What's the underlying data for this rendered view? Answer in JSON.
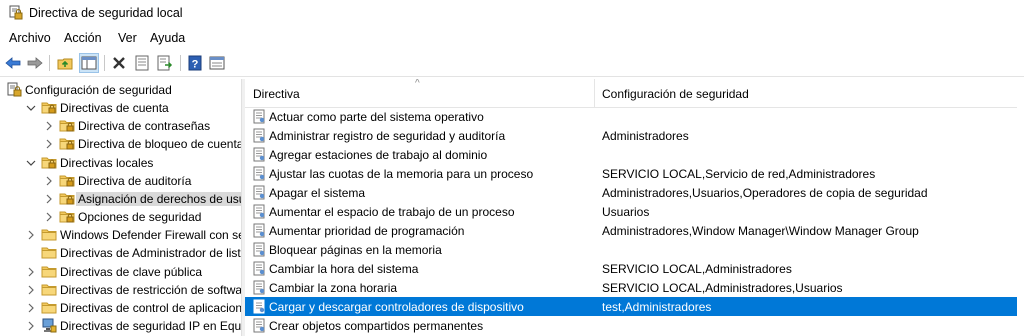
{
  "window": {
    "title": "Directiva de seguridad local"
  },
  "menu": [
    "Archivo",
    "Acción",
    "Ver",
    "Ayuda"
  ],
  "toolbar": {
    "icons": [
      "back-arrow-icon",
      "forward-arrow-icon",
      "up-folder-icon",
      "show-hide-tree-icon",
      "delete-icon",
      "properties-icon",
      "export-list-icon",
      "help-icon",
      "console-tree-icon"
    ]
  },
  "tree": {
    "items": [
      {
        "label": "Configuración de seguridad",
        "level": 0,
        "expander": "none",
        "icon": "security-config"
      },
      {
        "label": "Directivas de cuenta",
        "level": 1,
        "expander": "expanded",
        "icon": "folder-lock"
      },
      {
        "label": "Directiva de contraseñas",
        "level": 2,
        "expander": "collapsed",
        "icon": "folder-lock"
      },
      {
        "label": "Directiva de bloqueo de cuenta",
        "level": 2,
        "expander": "collapsed",
        "icon": "folder-lock"
      },
      {
        "label": "Directivas locales",
        "level": 1,
        "expander": "expanded",
        "icon": "folder-lock"
      },
      {
        "label": "Directiva de auditoría",
        "level": 2,
        "expander": "collapsed",
        "icon": "folder-lock"
      },
      {
        "label": "Asignación de derechos de usuari",
        "level": 2,
        "expander": "collapsed",
        "icon": "folder-lock",
        "selected": true
      },
      {
        "label": "Opciones de seguridad",
        "level": 2,
        "expander": "collapsed",
        "icon": "folder-lock"
      },
      {
        "label": "Windows Defender Firewall con segur",
        "level": 1,
        "expander": "collapsed",
        "icon": "folder"
      },
      {
        "label": "Directivas de Administrador de listas d",
        "level": 1,
        "expander": "none",
        "icon": "folder"
      },
      {
        "label": "Directivas de clave pública",
        "level": 1,
        "expander": "collapsed",
        "icon": "folder"
      },
      {
        "label": "Directivas de restricción de software",
        "level": 1,
        "expander": "collapsed",
        "icon": "folder"
      },
      {
        "label": "Directivas de control de aplicaciones",
        "level": 1,
        "expander": "collapsed",
        "icon": "folder"
      },
      {
        "label": "Directivas de seguridad IP en Equipo l",
        "level": 1,
        "expander": "collapsed",
        "icon": "ipsec"
      }
    ]
  },
  "list": {
    "col_policy": "Directiva",
    "col_setting": "Configuración de seguridad",
    "rows": [
      {
        "name": "Actuar como parte del sistema operativo",
        "value": ""
      },
      {
        "name": "Administrar registro de seguridad y auditoría",
        "value": "Administradores"
      },
      {
        "name": "Agregar estaciones de trabajo al dominio",
        "value": ""
      },
      {
        "name": "Ajustar las cuotas de la memoria para un proceso",
        "value": "SERVICIO LOCAL,Servicio de red,Administradores"
      },
      {
        "name": "Apagar el sistema",
        "value": "Administradores,Usuarios,Operadores de copia de seguridad"
      },
      {
        "name": "Aumentar el espacio de trabajo de un proceso",
        "value": "Usuarios"
      },
      {
        "name": "Aumentar prioridad de programación",
        "value": "Administradores,Window Manager\\Window Manager Group"
      },
      {
        "name": "Bloquear páginas en la memoria",
        "value": ""
      },
      {
        "name": "Cambiar la hora del sistema",
        "value": "SERVICIO LOCAL,Administradores"
      },
      {
        "name": "Cambiar la zona horaria",
        "value": "SERVICIO LOCAL,Administradores,Usuarios"
      },
      {
        "name": "Cargar y descargar controladores de dispositivo",
        "value": "test,Administradores",
        "selected": true
      },
      {
        "name": "Crear objetos compartidos permanentes",
        "value": ""
      }
    ]
  },
  "colors": {
    "selection": "#0078d7",
    "folder": "#f3c95e",
    "selected_tree": "#d9d9d9"
  }
}
